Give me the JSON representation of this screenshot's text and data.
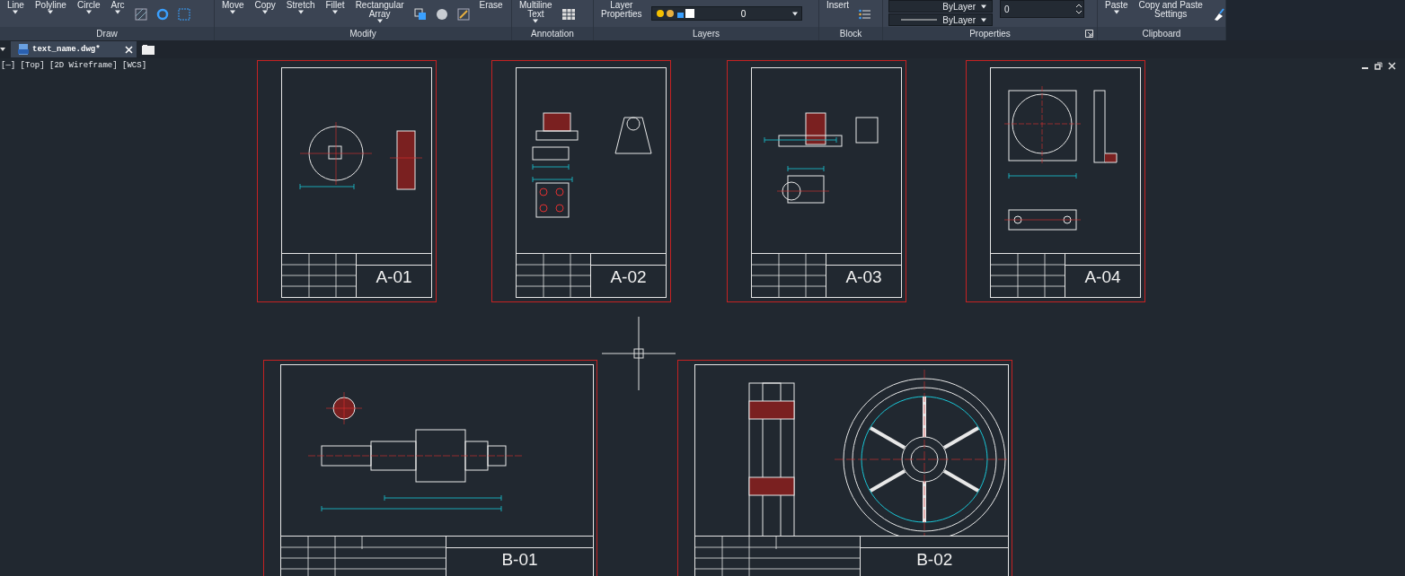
{
  "ribbon": {
    "panels": [
      {
        "title": "Draw",
        "tools": [
          {
            "label": "Line",
            "caret": true
          },
          {
            "label": "Polyline",
            "caret": true
          },
          {
            "label": "Circle",
            "caret": true
          },
          {
            "label": "Arc",
            "caret": true
          }
        ]
      },
      {
        "title": "Modify",
        "tools": [
          {
            "label": "Move",
            "caret": true
          },
          {
            "label": "Copy",
            "caret": true
          },
          {
            "label": "Stretch",
            "caret": true
          },
          {
            "label": "Fillet",
            "caret": true
          },
          {
            "label": "Rectangular\nArray",
            "caret": true
          }
        ],
        "extra": [
          {
            "label": "Erase",
            "caret": false
          }
        ]
      },
      {
        "title": "Annotation",
        "tools": [
          {
            "label": "Multiline\nText",
            "caret": true
          }
        ]
      },
      {
        "title": "Layers",
        "tools": [
          {
            "label": "Layer\nProperties",
            "caret": false
          }
        ],
        "layer": "0"
      },
      {
        "title": "Block",
        "tools": [
          {
            "label": "Insert",
            "caret": false
          }
        ]
      },
      {
        "title": "Properties",
        "bylayer": [
          "ByLayer",
          "ByLayer"
        ],
        "spinner": "0",
        "launcher": true
      },
      {
        "title": "Clipboard",
        "tools": [
          {
            "label": "Paste",
            "caret": true
          },
          {
            "label": "Copy and Paste\nSettings",
            "caret": false
          }
        ]
      }
    ]
  },
  "tabs": [
    {
      "label": "text_name.dwg*",
      "selected": true
    }
  ],
  "viewport": {
    "label": "[—] [Top] [2D Wireframe] [WCS]"
  },
  "sheets": [
    {
      "title": "A-01"
    },
    {
      "title": "A-02"
    },
    {
      "title": "A-03"
    },
    {
      "title": "A-04"
    },
    {
      "title": "B-01"
    },
    {
      "title": "B-02"
    }
  ]
}
